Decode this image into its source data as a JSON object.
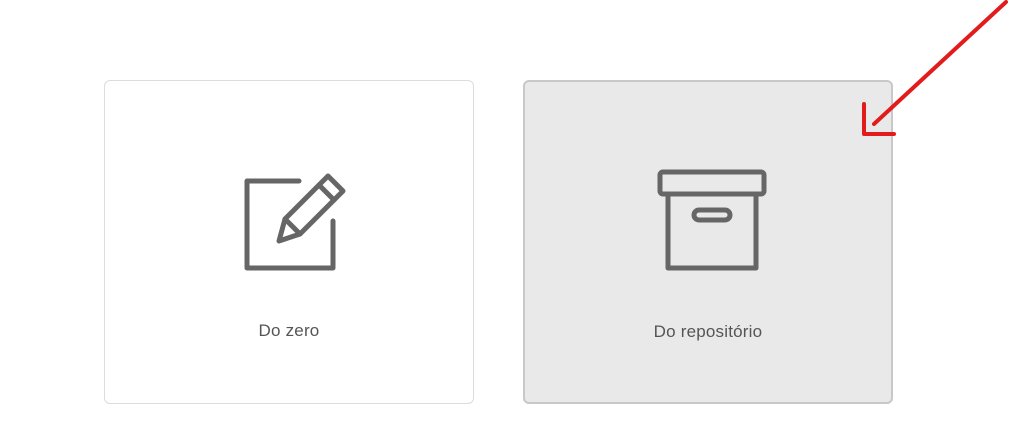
{
  "options": [
    {
      "label": "Do zero",
      "icon": "edit-icon",
      "state": "default"
    },
    {
      "label": "Do repositório",
      "icon": "archive-box-icon",
      "state": "selected"
    }
  ],
  "annotation": {
    "icon": "red-arrow-icon",
    "color": "#e21b1b"
  },
  "colors": {
    "icon": "#666666",
    "text": "#555555",
    "selected_bg": "#e9e9e9",
    "card_border": "#dcdcdc"
  }
}
